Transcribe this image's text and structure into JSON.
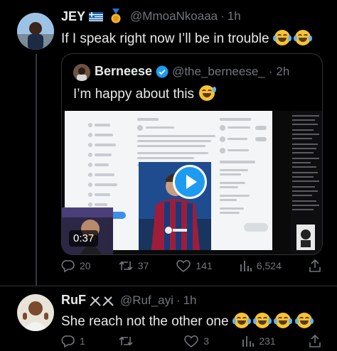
{
  "tweet": {
    "name": "JEY",
    "handle": "@MmoaNkoaaa",
    "time": "1h",
    "text": "If I speak right now I’ll be in trouble",
    "emojis": [
      "face-with-tears-of-joy",
      "face-with-tears-of-joy"
    ],
    "flag_icon": "greek-flag-icon",
    "medal_icon": "medal-icon",
    "replies": "20",
    "retweets": "37",
    "likes": "141",
    "views": "6,524"
  },
  "quote": {
    "name": "Berneese",
    "handle": "@the_berneese_",
    "time": "2h",
    "text": "I’m happy about this",
    "emoji": "grinning-face-with-sweat",
    "video_duration": "0:37"
  },
  "reply": {
    "name": "RuF",
    "handle": "@Ruf_ayi",
    "time": "1h",
    "text": "She reach not the other one",
    "emojis": [
      "face-with-tears-of-joy",
      "face-with-tears-of-joy",
      "face-with-tears-of-joy",
      "face-with-tears-of-joy"
    ],
    "replies": "1",
    "retweets": "",
    "likes": "3",
    "views": "231"
  },
  "colors": {
    "background": "#000000",
    "text": "#e7e9ea",
    "muted": "#71767b",
    "verified": "#1d9bf0",
    "border": "#2f3336"
  }
}
